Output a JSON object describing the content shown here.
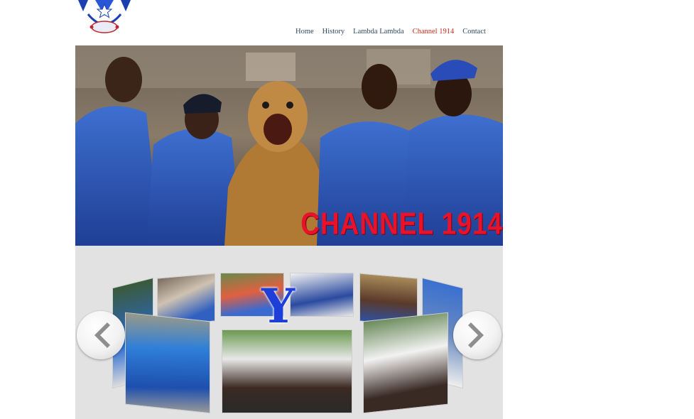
{
  "logo": {
    "alt": "Lambda Lambda chapter crest",
    "icon": "chapter-crest-icon"
  },
  "nav": {
    "items": [
      {
        "label": "Home",
        "active": false
      },
      {
        "label": "History",
        "active": false
      },
      {
        "label": "Lambda Lambda",
        "active": false
      },
      {
        "label": "Channel 1914",
        "active": true
      },
      {
        "label": "Contact",
        "active": false
      }
    ]
  },
  "banner": {
    "title": "CHANNEL 1914",
    "title_color": "#e8132b"
  },
  "gallery": {
    "overlay_glyph": "Υ",
    "background": "#e2e2e2",
    "prev_icon": "chevron-left-icon",
    "next_icon": "chevron-right-icon"
  },
  "colors": {
    "nav_text": "#2e4a63",
    "nav_active": "#cc2a1b",
    "brand_blue": "#1e3ed8"
  }
}
